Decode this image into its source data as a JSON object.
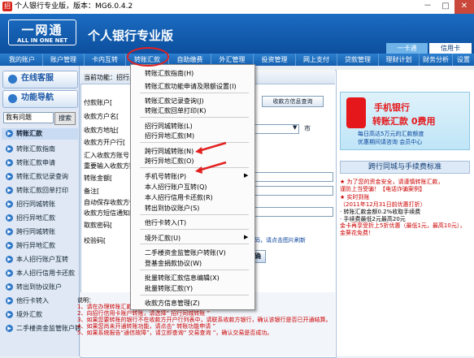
{
  "window": {
    "title": "个人银行专业版，版本：MG6.0.4.2",
    "controls": [
      "－",
      "□",
      "✕"
    ]
  },
  "header": {
    "logo_cn": "一网通",
    "logo_en": "ALL IN ONE NET",
    "product": "个人银行专业版",
    "card_tabs": [
      "一卡通",
      "信用卡"
    ]
  },
  "nav": {
    "items": [
      "我的账户",
      "账户管理",
      "卡内互转",
      "转账汇款",
      "自助缴费",
      "外汇管理",
      "投资管理",
      "网上支付",
      "贷款管理",
      "理财计划",
      "财务分析",
      "设置"
    ]
  },
  "sidebar": {
    "online_service": "在线客服",
    "func_nav": "功能导航",
    "search_value": "我有问题",
    "search_btn": "搜索",
    "items": [
      "转账汇款",
      "转账汇款指南",
      "转账汇款申请",
      "转账汇款记录查询",
      "转账汇款回单打印",
      "招行同城转账",
      "招行异地汇款",
      "跨行同城转账",
      "跨行异地汇款",
      "本人招行账户互转",
      "本人招行信用卡还款",
      "转出到协议账户",
      "他行卡转入",
      "境外汇款",
      "二手楼资金监管账户转账"
    ]
  },
  "main": {
    "breadcrumb": "当前功能：招行异",
    "labels": [
      "付款账户[",
      "收款方户名[",
      "收款方地址[",
      "收款方开户行[",
      "汇入收款方账号",
      "重要输入收款方账",
      "转账金额[",
      "备注[",
      "自动保存收款方信",
      "收款方短信通知[",
      "取款密码[",
      "校验码["
    ],
    "query_btn": "收款方信息查询",
    "city_suffix": "市",
    "captcha_hint": "码，请点击图片刷新",
    "submit_btn": "确"
  },
  "menu": {
    "items": [
      "转账汇款指南(H)",
      "转账汇款功能申请及限额设置(I)",
      "转账汇款记录查询(J)",
      "转账汇款回单打印(K)",
      "招行同城转账(L)",
      "招行异地汇款(M)",
      "跨行同城转账(N)",
      "跨行异地汇款(O)",
      "手机号转账(P)",
      "本人招行账户互转(Q)",
      "本人招行信用卡还款(R)",
      "转出到协议账户(S)",
      "他行卡转入(T)",
      "境外汇款(U)",
      "二手楼资金监管账户转账(V)",
      "登基金捐款协议(W)",
      "批量转账汇款信息编辑(X)",
      "批量转账汇款(Y)",
      "收款方信息管理(Z)"
    ]
  },
  "notes": {
    "title": "说明：",
    "lines": [
      "1、请在办理转账汇款前，请先选择“ 招行同城转账 ”",
      "2、向招行信用卡账户转账，请选择“ 招行同城转账 ”",
      "3、如果您要转账的银行不在收款方开户行列表中，请联系收款方银行，确认该银行是否已开通结算。",
      "4、如果您尚未开通转账功能，请点击“ 转账功能申请 ”",
      "5、如果系统报告“通信故障”，请立即查询“ 交易查询 ”，确认交易是否成功。"
    ]
  },
  "right": {
    "ad_title": "手机银行",
    "ad_subtitle": "转账汇款 0费用",
    "ad_lines": [
      "每日高达5万元的汇款额度",
      "优惠期间请咨询 会员中心"
    ],
    "fee_title": "跨行同城与手续费标准",
    "fee_lines": [
      "★ 为了您的资金安全，请谨慎转账汇款，",
      "谨防上当受骗！【电话诈骗案例】",
      "★ 实时到账",
      "（2011年12月31日前优惠打折）",
      "· 转账汇款金额0.2%收取手续费",
      "· 手续费最低2元最高20元",
      "金卡再享受折上5折优惠（最低1元，最高10元），金葵花免费！"
    ]
  },
  "colors": {
    "header_blue": "#1b6cc2",
    "alert_red": "#e32020",
    "link_blue": "#08449c"
  }
}
